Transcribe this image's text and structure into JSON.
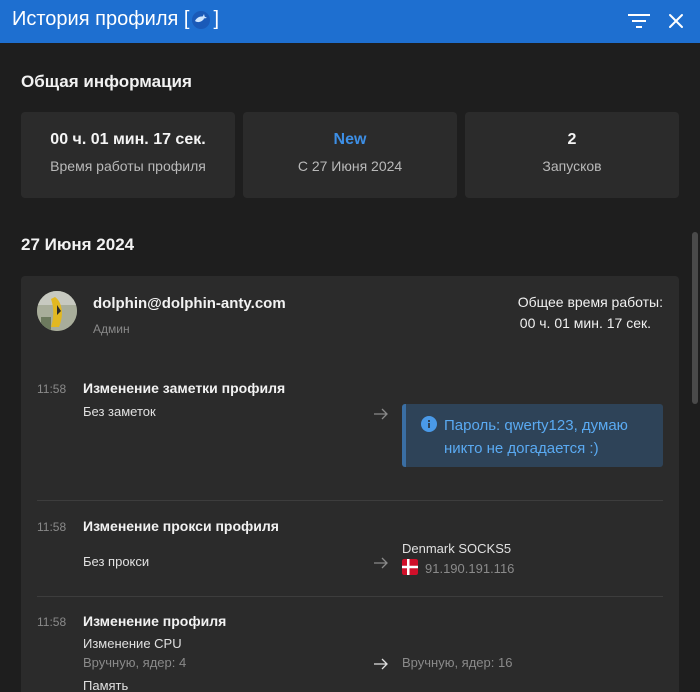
{
  "window": {
    "title_prefix": "История профиля [",
    "title_suffix": "]"
  },
  "general": {
    "title": "Общая информация",
    "stats": [
      {
        "value": "00 ч. 01 мин. 17 сек.",
        "label": "Время работы профиля"
      },
      {
        "value": "New",
        "label": "С 27 Июня 2024"
      },
      {
        "value": "2",
        "label": "Запусков"
      }
    ]
  },
  "day": {
    "title": "27 Июня 2024",
    "user": {
      "email": "dolphin@dolphin-anty.com",
      "role": "Админ"
    },
    "total_label": "Общее время работы:",
    "total_value": "00 ч. 01 мин. 17 сек.",
    "events": [
      {
        "time": "11:58",
        "title": "Изменение заметки профиля",
        "from": "Без заметок",
        "to": "Пароль: qwerty123, думаю никто не догадается :)"
      },
      {
        "time": "11:58",
        "title": "Изменение прокси профиля",
        "from": "Без прокси",
        "to_name": "Denmark SOCKS5",
        "to_ip": "91.190.191.116"
      },
      {
        "time": "11:58",
        "title": "Изменение профиля",
        "field": "Изменение CPU",
        "from": "Вручную, ядер: 4",
        "to": "Вручную, ядер: 16",
        "next_field": "Память"
      }
    ]
  },
  "colors": {
    "titlebar": "#1e6fd0",
    "accent": "#3d8fe6",
    "note_bg": "#2e4358",
    "note_text": "#5aaaf2"
  }
}
